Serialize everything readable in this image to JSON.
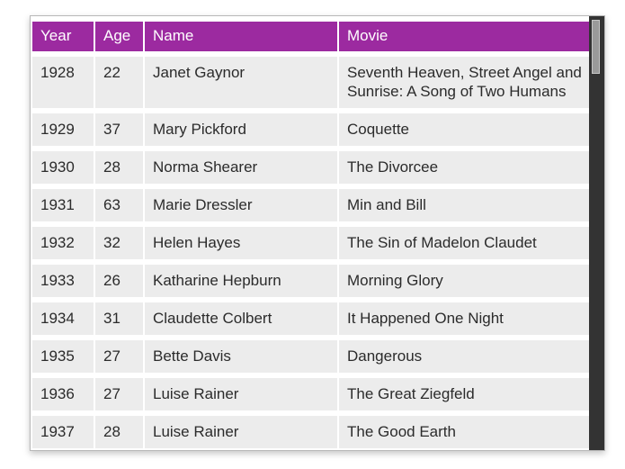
{
  "table": {
    "columns": [
      "Year",
      "Age",
      "Name",
      "Movie"
    ],
    "rows": [
      {
        "year": "1928",
        "age": "22",
        "name": "Janet Gaynor",
        "movie": "Seventh Heaven, Street Angel and Sunrise: A Song of Two Humans"
      },
      {
        "year": "1929",
        "age": "37",
        "name": "Mary Pickford",
        "movie": "Coquette"
      },
      {
        "year": "1930",
        "age": "28",
        "name": "Norma Shearer",
        "movie": "The Divorcee"
      },
      {
        "year": "1931",
        "age": "63",
        "name": "Marie Dressler",
        "movie": "Min and Bill"
      },
      {
        "year": "1932",
        "age": "32",
        "name": "Helen Hayes",
        "movie": "The Sin of Madelon Claudet"
      },
      {
        "year": "1933",
        "age": "26",
        "name": "Katharine Hepburn",
        "movie": "Morning Glory"
      },
      {
        "year": "1934",
        "age": "31",
        "name": "Claudette Colbert",
        "movie": "It Happened One Night"
      },
      {
        "year": "1935",
        "age": "27",
        "name": "Bette Davis",
        "movie": "Dangerous"
      },
      {
        "year": "1936",
        "age": "27",
        "name": "Luise Rainer",
        "movie": "The Great Ziegfeld"
      },
      {
        "year": "1937",
        "age": "28",
        "name": "Luise Rainer",
        "movie": "The Good Earth"
      }
    ]
  },
  "colors": {
    "header_background": "#9c2aa0",
    "header_text": "#ffffff",
    "cell_background": "#ececec",
    "cell_text": "#2b2b2b",
    "page_background": "#ffffff",
    "scrollbar_track": "#333333",
    "scrollbar_thumb": "#9a9a9a"
  }
}
